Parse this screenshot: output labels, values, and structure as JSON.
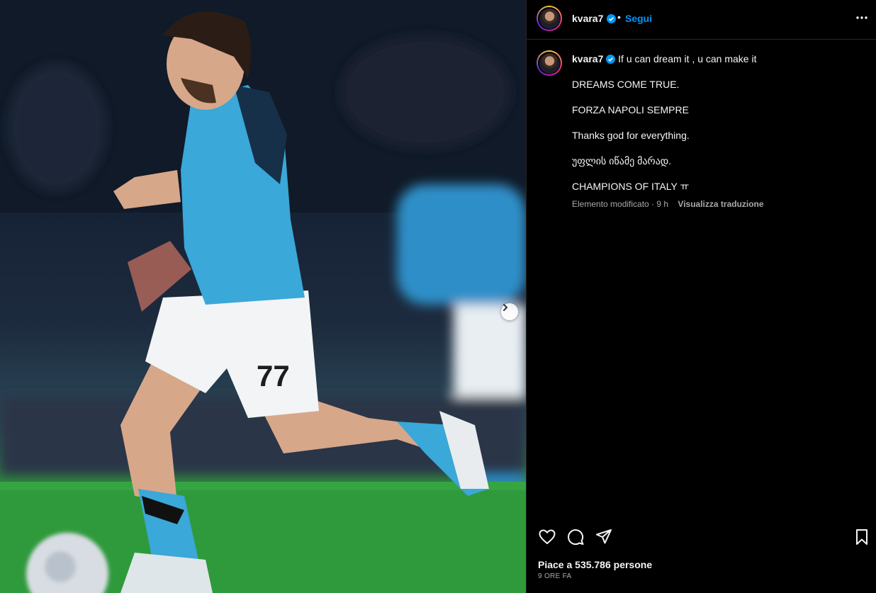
{
  "post": {
    "image_alt": "Player in light blue jersey number 77 running with the ball",
    "jersey_number": "77"
  },
  "header": {
    "username": "kvara7",
    "separator": "•",
    "follow_label": "Segui",
    "more_icon": "more-horizontal-icon",
    "verified_icon": "verified-badge-icon"
  },
  "caption": {
    "username": "kvara7",
    "first_line": "If u can dream it , u can make it",
    "lines": [
      "DREAMS COME TRUE.",
      "FORZA NAPOLI SEMPRE",
      "Thanks god for everything.",
      "უფლის იწამე მარად.",
      "CHAMPIONS OF ITALY ㅠ"
    ],
    "meta": "Elemento modificato · 9 h",
    "translate_label": "Visualizza traduzione"
  },
  "actions": {
    "like_icon": "heart-icon",
    "comment_icon": "comment-icon",
    "share_icon": "share-icon",
    "save_icon": "bookmark-icon"
  },
  "likes_text": "Piace a 535.786 persone",
  "timestamp": "9 ORE FA",
  "colors": {
    "accent": "#0095f6",
    "verified": "#0095f6",
    "jersey": "#3aa8d8",
    "background": "#000000"
  }
}
